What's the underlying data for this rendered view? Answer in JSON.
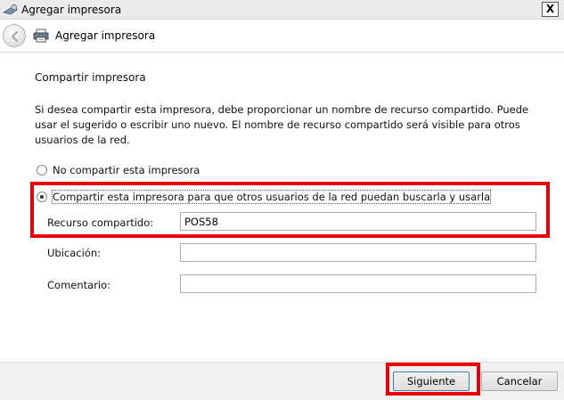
{
  "window": {
    "title": "Agregar impresora",
    "close_label": "X"
  },
  "nav": {
    "title": "Agregar impresora"
  },
  "page": {
    "heading": "Compartir impresora",
    "description": "Si desea compartir esta impresora, debe proporcionar un nombre de recurso compartido. Puede usar el sugerido o escribir uno nuevo. El nombre de recurso compartido será visible para otros usuarios de la red."
  },
  "options": {
    "no_share_label": "No compartir esta impresora",
    "share_label": "Compartir esta impresora para que otros usuarios de la red puedan buscarla y usarla",
    "selected": "share"
  },
  "fields": {
    "share_name_label": "Recurso compartido:",
    "share_name_value": "POS58",
    "location_label": "Ubicación:",
    "location_value": "",
    "comment_label": "Comentario:",
    "comment_value": ""
  },
  "buttons": {
    "next_label": "Siguiente",
    "cancel_label": "Cancelar"
  },
  "colors": {
    "highlight": "#e8000b"
  }
}
